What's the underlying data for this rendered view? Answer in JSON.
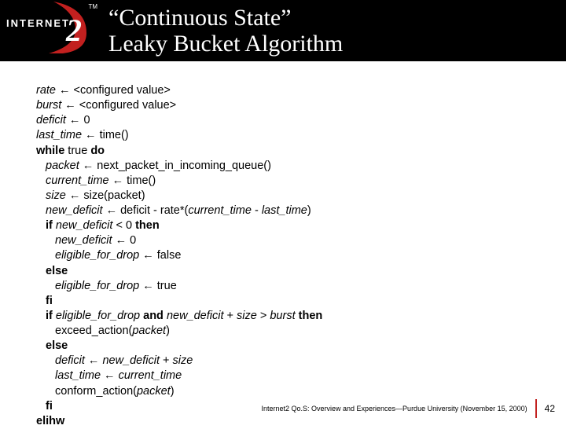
{
  "header": {
    "logo_text": "INTERNET",
    "logo_tm": "TM",
    "title_line1": "“Continuous State”",
    "title_line2": "Leaky Bucket Algorithm"
  },
  "code": {
    "l01_a": "rate",
    "l01_b": " ← <configured value>",
    "l02_a": "burst",
    "l02_b": " ← <configured value>",
    "l03_a": "deficit",
    "l03_b": " ← 0",
    "l04_a": "last_time",
    "l04_b": " ← time()",
    "l05_a": "while ",
    "l05_b": "true ",
    "l05_c": "do",
    "l06_a": "packet",
    "l06_b": " ← next_packet_in_incoming_queue()",
    "l07_a": "current_time",
    "l07_b": " ← time()",
    "l08_a": "size",
    "l08_b": " ← size(packet)",
    "l09_a": "new_deficit",
    "l09_b": " ← deficit - rate*(",
    "l09_c": "current_time",
    "l09_d": " - ",
    "l09_e": "last_time",
    "l09_f": ")",
    "l10_a": "if ",
    "l10_b": "new_deficit",
    "l10_c": " < 0 ",
    "l10_d": "then",
    "l11_a": "new_deficit",
    "l11_b": " ← 0",
    "l12_a": "eligible_for_drop",
    "l12_b": " ← false",
    "l13": "else",
    "l14_a": "eligible_for_drop",
    "l14_b": " ← true",
    "l15": "fi",
    "l16_a": "if ",
    "l16_b": "eligible_for_drop",
    "l16_c": " and ",
    "l16_d": "new_deficit",
    "l16_e": " + ",
    "l16_f": "size",
    "l16_g": " > ",
    "l16_h": "burst",
    "l16_i": " then",
    "l17_a": "exceed_action(",
    "l17_b": "packet",
    "l17_c": ")",
    "l18": "else",
    "l19_a": "deficit",
    "l19_b": " ← ",
    "l19_c": "new_deficit",
    "l19_d": " + ",
    "l19_e": "size",
    "l20_a": "last_time",
    "l20_b": " ← ",
    "l20_c": "current_time",
    "l21_a": "conform_action(",
    "l21_b": "packet",
    "l21_c": ")",
    "l22": "fi",
    "l23": "elihw"
  },
  "footer": {
    "text": "Internet2 Qo.S: Overview and Experiences—Purdue University (November 15, 2000)",
    "page": "42"
  }
}
